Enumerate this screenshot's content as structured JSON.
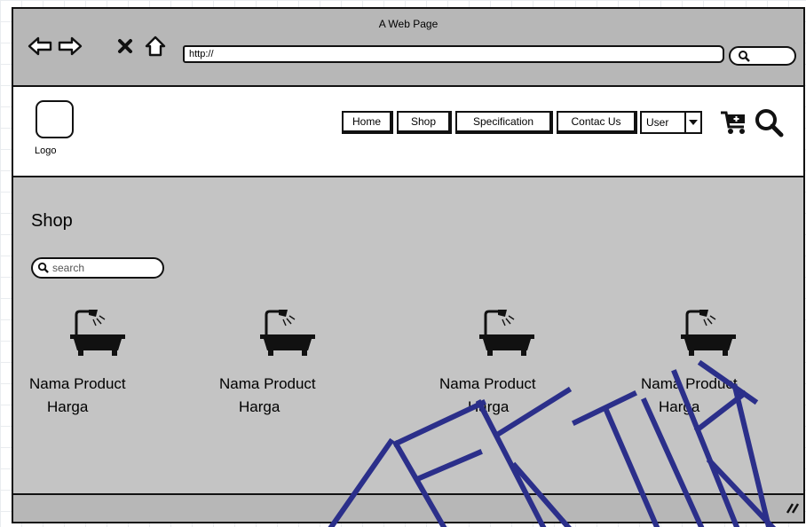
{
  "window": {
    "title": "A Web Page"
  },
  "browser": {
    "url": "http://",
    "nav_icons": [
      "back-arrow-icon",
      "forward-arrow-icon",
      "stop-icon",
      "home-icon"
    ]
  },
  "header": {
    "logo_label": "Logo",
    "menu": [
      "Home",
      "Shop",
      "Specification",
      "Contac Us"
    ],
    "user_select": "User"
  },
  "main": {
    "title": "Shop",
    "search_placeholder": "search",
    "products": [
      {
        "name": "Nama Product",
        "price": "Harga",
        "icon": "bathtub-icon"
      },
      {
        "name": "Nama Product",
        "price": "Harga",
        "icon": "bathtub-icon"
      },
      {
        "name": "Nama Product",
        "price": "Harga",
        "icon": "bathtub-icon"
      },
      {
        "name": "Nama Product",
        "price": "Harga",
        "icon": "bathtub-icon"
      }
    ]
  },
  "watermark": {
    "text": "TEKTIKA",
    "color": "#2b2f8a"
  },
  "colors": {
    "chrome": "#b7b7b7",
    "content": "#c4c4c4",
    "border": "#111111"
  }
}
